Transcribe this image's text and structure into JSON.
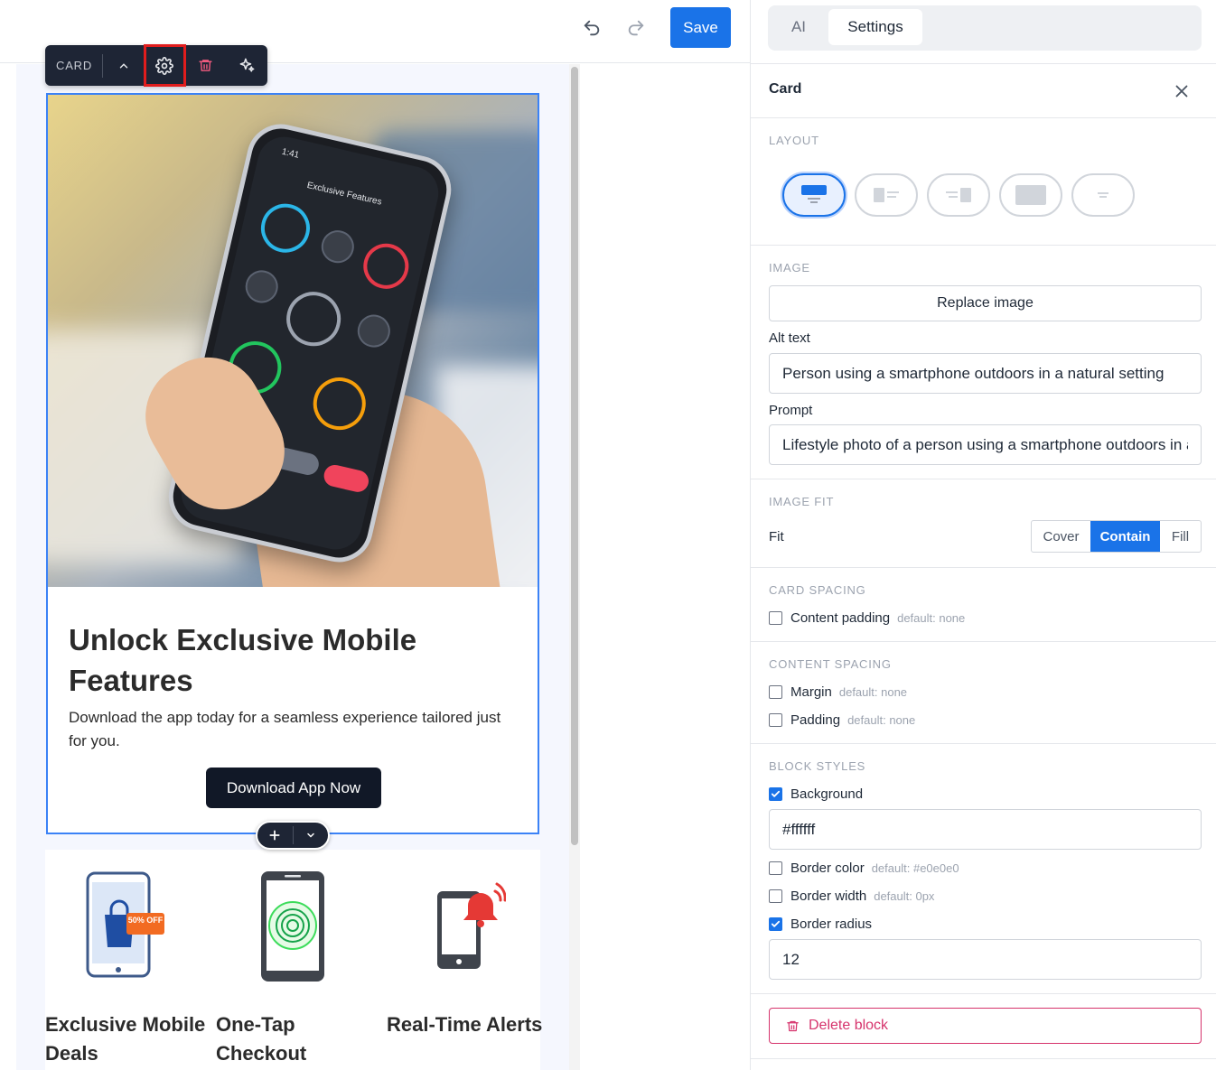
{
  "toolbar": {
    "save_label": "Save",
    "undo_icon": "undo-icon",
    "redo_icon": "redo-icon"
  },
  "block_toolbar": {
    "label": "CARD",
    "actions": [
      "move-up",
      "settings",
      "delete",
      "ai-magic"
    ]
  },
  "card": {
    "phone_time": "1:41",
    "phone_title": "Exclusive Features",
    "title": "Unlock Exclusive Mobile Features",
    "description": "Download the app today for a seamless experience tailored just for you.",
    "cta": "Download App Now"
  },
  "features": [
    {
      "title": "Exclusive Mobile Deals",
      "badge": "50% OFF"
    },
    {
      "title": "One-Tap Checkout"
    },
    {
      "title": "Real-Time Alerts"
    }
  ],
  "panel": {
    "tabs": [
      {
        "label": "AI",
        "active": false
      },
      {
        "label": "Settings",
        "active": true
      }
    ],
    "title": "Card",
    "sections": {
      "layout": "LAYOUT",
      "image": "IMAGE",
      "image_fit": "IMAGE FIT",
      "card_spacing": "CARD SPACING",
      "content_spacing": "CONTENT SPACING",
      "block_styles": "BLOCK STYLES"
    },
    "replace_image": "Replace image",
    "alt_text_label": "Alt text",
    "alt_text_value": "Person using a smartphone outdoors in a natural setting",
    "prompt_label": "Prompt",
    "prompt_value": "Lifestyle photo of a person using a smartphone outdoors in a natural setting",
    "fit_label": "Fit",
    "fit_options": [
      "Cover",
      "Contain",
      "Fill"
    ],
    "fit_selected": "Contain",
    "content_padding": {
      "label": "Content padding",
      "default": "default: none",
      "checked": false
    },
    "margin": {
      "label": "Margin",
      "default": "default: none",
      "checked": false
    },
    "padding": {
      "label": "Padding",
      "default": "default: none",
      "checked": false
    },
    "background": {
      "label": "Background",
      "checked": true,
      "value": "#ffffff"
    },
    "border_color": {
      "label": "Border color",
      "default": "default: #e0e0e0",
      "checked": false
    },
    "border_width": {
      "label": "Border width",
      "default": "default: 0px",
      "checked": false
    },
    "border_radius": {
      "label": "Border radius",
      "checked": true,
      "value": "12"
    },
    "delete_label": "Delete block"
  },
  "colors": {
    "accent": "#1a73e8",
    "toolbar_dark": "#1e2535",
    "danger": "#d6336c",
    "cta_dark": "#111827"
  }
}
